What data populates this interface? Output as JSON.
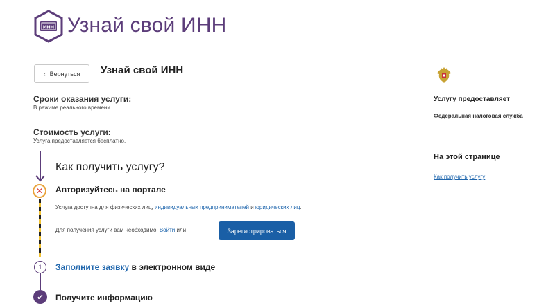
{
  "header": {
    "title": "Узнай свой ИНН",
    "logo_text": "ИНН"
  },
  "nav": {
    "back_label": "Вернуться"
  },
  "service": {
    "title": "Узнай свой ИНН"
  },
  "terms": {
    "label": "Сроки оказания услуги:",
    "text": "В режиме реального времени."
  },
  "cost": {
    "label": "Стоимость услуги:",
    "text": "Услуга предоставляется бесплатно."
  },
  "steps": {
    "title": "Как получить услугу?",
    "step1": {
      "title": "Авторизуйтесь на портале",
      "desc_prefix": "Услуга доступна для физических лиц, ",
      "desc_link1": "индивидуальных предпринимателей",
      "desc_mid": " и ",
      "desc_link2": "юридических лиц",
      "desc_suffix": ".",
      "req_prefix": "Для получения услуги вам необходимо: ",
      "login_link": "Войти",
      "req_mid": " или",
      "register_label": "Зарегистрироваться"
    },
    "step2": {
      "number": "1",
      "title_link": "Заполните заявку",
      "title_rest": " в электронном виде"
    },
    "step3": {
      "title": "Получите информацию"
    }
  },
  "sidebar": {
    "provider_label": "Услугу предоставляет",
    "provider_name": "Федеральная налоговая служба",
    "onpage_label": "На этой странице",
    "onpage_link": "Как получить услугу"
  },
  "colors": {
    "brand": "#5c3d7a",
    "link": "#1f66ad",
    "button": "#1a5fa6",
    "warning_ring": "#e9a23b",
    "error": "#d9383a"
  }
}
